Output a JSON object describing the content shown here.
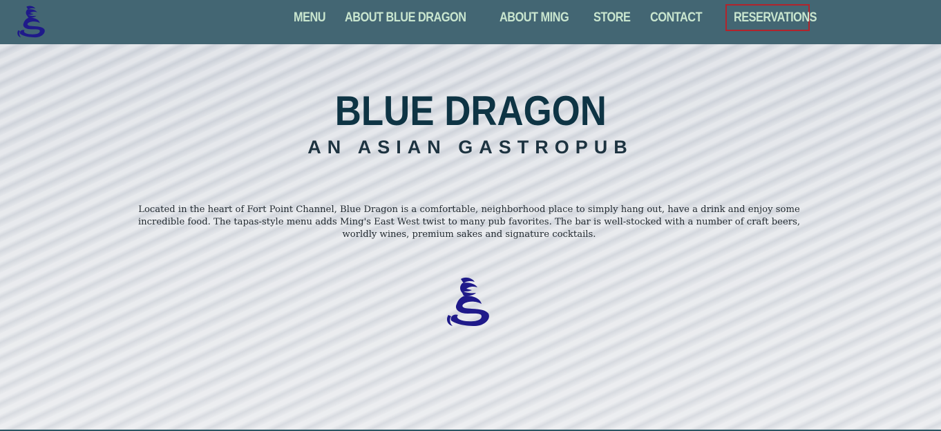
{
  "header": {
    "logo_icon": "dragon-logo-icon",
    "nav": [
      {
        "label": "MENU"
      },
      {
        "label": "ABOUT BLUE DRAGON"
      },
      {
        "label": "ABOUT MING"
      },
      {
        "label": "STORE"
      },
      {
        "label": "CONTACT"
      },
      {
        "label": "RESERVATIONS"
      }
    ],
    "colors": {
      "nav_background": "#436673",
      "nav_text": "#c9e6cf",
      "reservations_border": "#b3232b"
    }
  },
  "hero": {
    "title": "BLUE DRAGON",
    "subtitle": "AN ASIAN GASTROPUB",
    "description": "Located in the heart of Fort Point Channel, Blue Dragon is a comfortable, neighborhood place to simply hang out, have a drink and enjoy some incredible food. The tapas-style menu adds Ming's East West twist to many pub favorites. The bar is well-stocked with a number of craft beers, worldly wines, premium sakes and signature cocktails.",
    "logo_icon": "dragon-logo-icon",
    "colors": {
      "title": "#0e3444",
      "logo": "#1f1a8a"
    }
  }
}
